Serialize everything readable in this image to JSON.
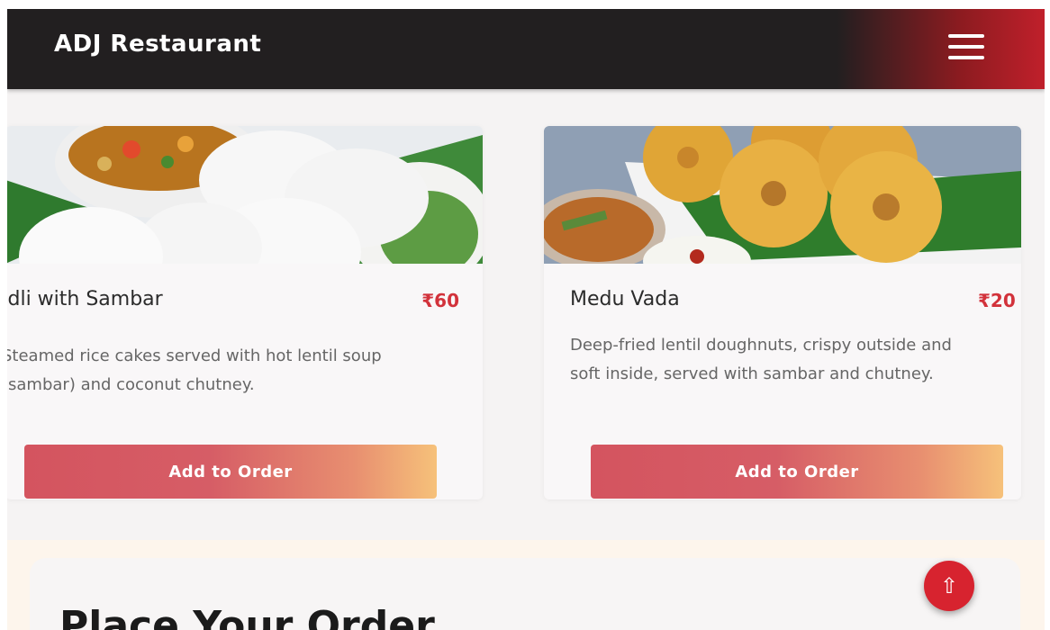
{
  "header": {
    "brand": "ADJ Restaurant",
    "menu_icon": "hamburger-menu-icon"
  },
  "menu_items": [
    {
      "name": "Idli with Sambar",
      "price": "₹60",
      "description": "Steamed rice cakes served with hot lentil soup (sambar) and coconut chutney.",
      "button_label": "Add to Order",
      "image": "idli-with-sambar-photo"
    },
    {
      "name": "Medu Vada",
      "price": "₹20",
      "description": "Deep-fried lentil doughnuts, crispy outside and soft inside, served with sambar and chutney.",
      "button_label": "Add to Order",
      "image": "medu-vada-photo"
    }
  ],
  "order_section": {
    "title": "Place Your Order"
  },
  "scroll_top": {
    "icon": "up-arrow-icon",
    "glyph": "⇧"
  },
  "colors": {
    "header_bg": "#221f20",
    "accent_red": "#d2323b",
    "button_gradient_start": "#d4545f",
    "button_gradient_end": "#f6c17a",
    "scroll_button": "#d7232f"
  }
}
